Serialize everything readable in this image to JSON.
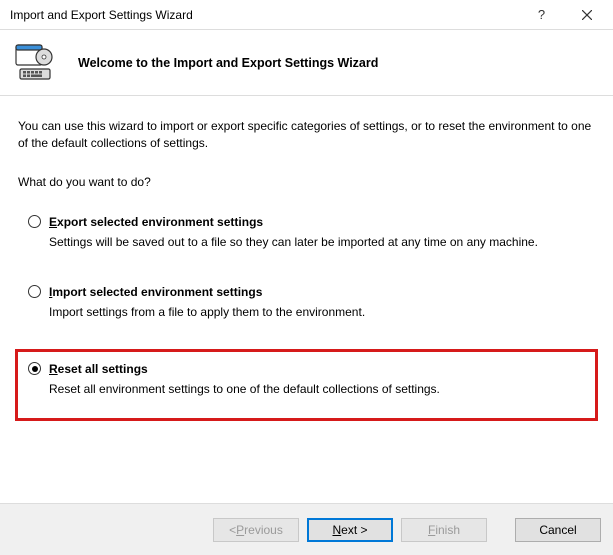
{
  "titlebar": {
    "title": "Import and Export Settings Wizard",
    "help": "?",
    "close": "✕"
  },
  "header": {
    "title": "Welcome to the Import and Export Settings Wizard"
  },
  "content": {
    "intro": "You can use this wizard to import or export specific categories of settings, or to reset the environment to one of the default collections of settings.",
    "prompt": "What do you want to do?",
    "options": [
      {
        "labelFirst": "E",
        "labelRest": "xport selected environment settings",
        "desc": "Settings will be saved out to a file so they can later be imported at any time on any machine.",
        "selected": false,
        "highlighted": false
      },
      {
        "labelFirst": "I",
        "labelRest": "mport selected environment settings",
        "desc": "Import settings from a file to apply them to the environment.",
        "selected": false,
        "highlighted": false
      },
      {
        "labelFirst": "R",
        "labelRest": "eset all settings",
        "desc": "Reset all environment settings to one of the default collections of settings.",
        "selected": true,
        "highlighted": true
      }
    ]
  },
  "footer": {
    "previous_pre": "< ",
    "previous_u": "P",
    "previous_post": "revious",
    "next_u": "N",
    "next_post": "ext >",
    "finish_u": "F",
    "finish_post": "inish",
    "cancel": "Cancel"
  }
}
